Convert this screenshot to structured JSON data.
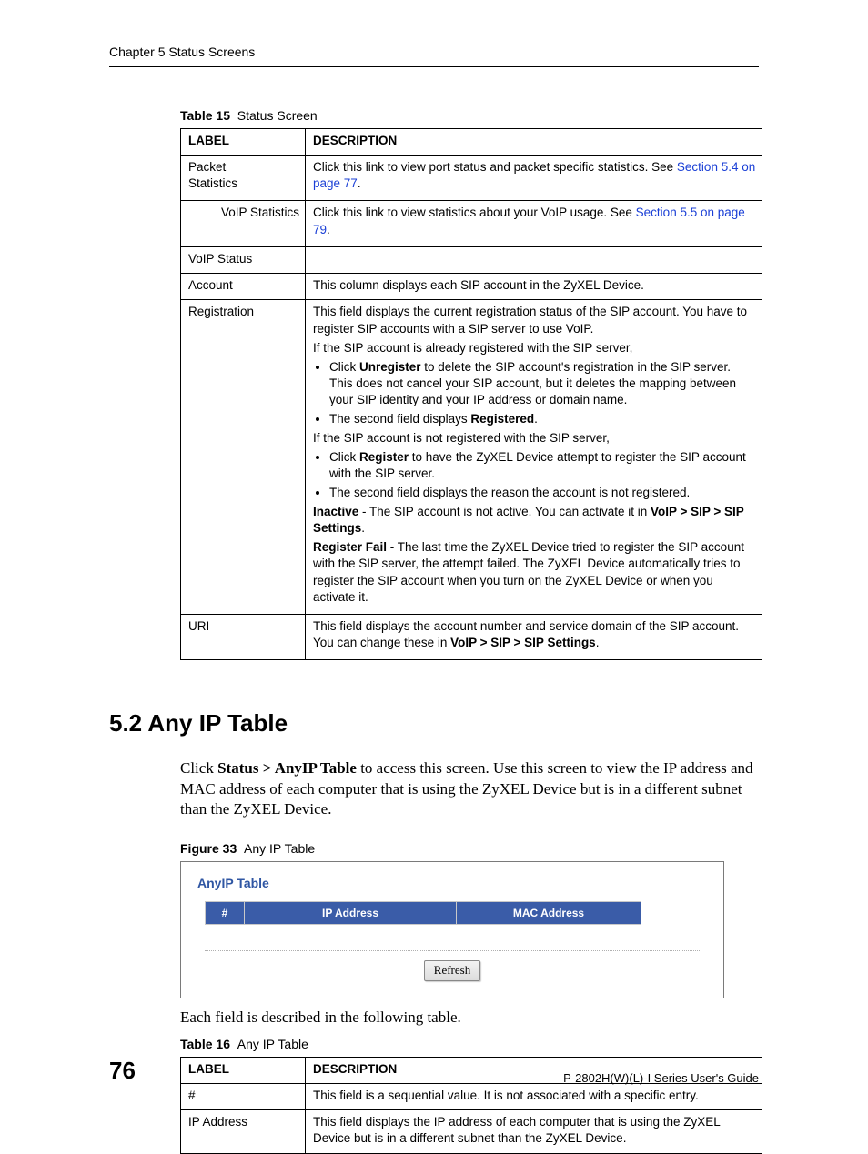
{
  "header": {
    "chapter": "Chapter 5 Status Screens"
  },
  "table15": {
    "caption_label": "Table 15",
    "caption_text": "Status Screen",
    "head_label": "LABEL",
    "head_desc": "DESCRIPTION",
    "rows": {
      "r0": {
        "label": "Packet\nStatistics",
        "p0": "Click this link to view port status and packet specific statistics. See ",
        "link0": "Section 5.4 on page 77",
        "tail0": "."
      },
      "r1": {
        "label": "VoIP Statistics",
        "p0": "Click this link to view statistics about your VoIP usage. See ",
        "link0": "Section 5.5 on page 79",
        "tail0": "."
      },
      "r2": {
        "label": "VoIP Status",
        "desc": ""
      },
      "r3": {
        "label": "Account",
        "desc": "This column displays each SIP account in the ZyXEL Device."
      },
      "r4": {
        "label": "Registration",
        "p0": "This field displays the current registration status of the SIP account. You have to register SIP accounts with a SIP server to use VoIP.",
        "p1": "If the SIP account is already registered with the SIP server,",
        "b0a": "Click ",
        "b0b": "Unregister",
        "b0c": " to delete the SIP account's registration in the SIP server. This does not cancel your SIP account, but it deletes the mapping between your SIP identity and your IP address or domain name.",
        "b1a": "The second field displays ",
        "b1b": "Registered",
        "b1c": ".",
        "p2": "If the SIP account is not registered with the SIP server,",
        "b2a": "Click ",
        "b2b": "Register",
        "b2c": " to have the ZyXEL Device attempt to register the SIP account with the SIP server.",
        "b3": "The second field displays the reason the account is not registered.",
        "p3a": "Inactive",
        "p3b": " - The SIP account is not active. You can activate it in ",
        "p3c": "VoIP > SIP > SIP Settings",
        "p3d": ".",
        "p4a": "Register Fail",
        "p4b": " - The last time the ZyXEL Device tried to register the SIP account with the SIP server, the attempt failed. The ZyXEL Device automatically tries to register the SIP account when you turn on the ZyXEL Device or when you activate it."
      },
      "r5": {
        "label": "URI",
        "p0": "This field displays the account number and service domain of the SIP account. You can change these in ",
        "p0b": "VoIP > SIP > SIP Settings",
        "p0c": "."
      }
    }
  },
  "section": {
    "heading": "5.2  Any IP Table",
    "body_a": "Click ",
    "body_b": "Status > AnyIP Table",
    "body_c": " to access this screen. Use this screen to view the IP address and MAC address of each computer that is using the ZyXEL Device but is in a different subnet than the ZyXEL Device."
  },
  "figure33": {
    "caption_label": "Figure 33",
    "caption_text": "Any IP Table",
    "panel_title": "AnyIP Table",
    "col_num": "#",
    "col_ip": "IP Address",
    "col_mac": "MAC Address",
    "refresh": "Refresh"
  },
  "after_figure": "Each field is described in the following table.",
  "table16": {
    "caption_label": "Table 16",
    "caption_text": "Any IP Table",
    "head_label": "LABEL",
    "head_desc": "DESCRIPTION",
    "rows": {
      "r0": {
        "label": "#",
        "desc": "This field is a sequential value. It is not associated with a specific entry."
      },
      "r1": {
        "label": "IP Address",
        "desc": "This field displays the IP address of each computer that is using the ZyXEL Device but is in a different subnet than the ZyXEL Device."
      }
    }
  },
  "footer": {
    "page": "76",
    "guide": "P-2802H(W)(L)-I Series User's Guide"
  }
}
